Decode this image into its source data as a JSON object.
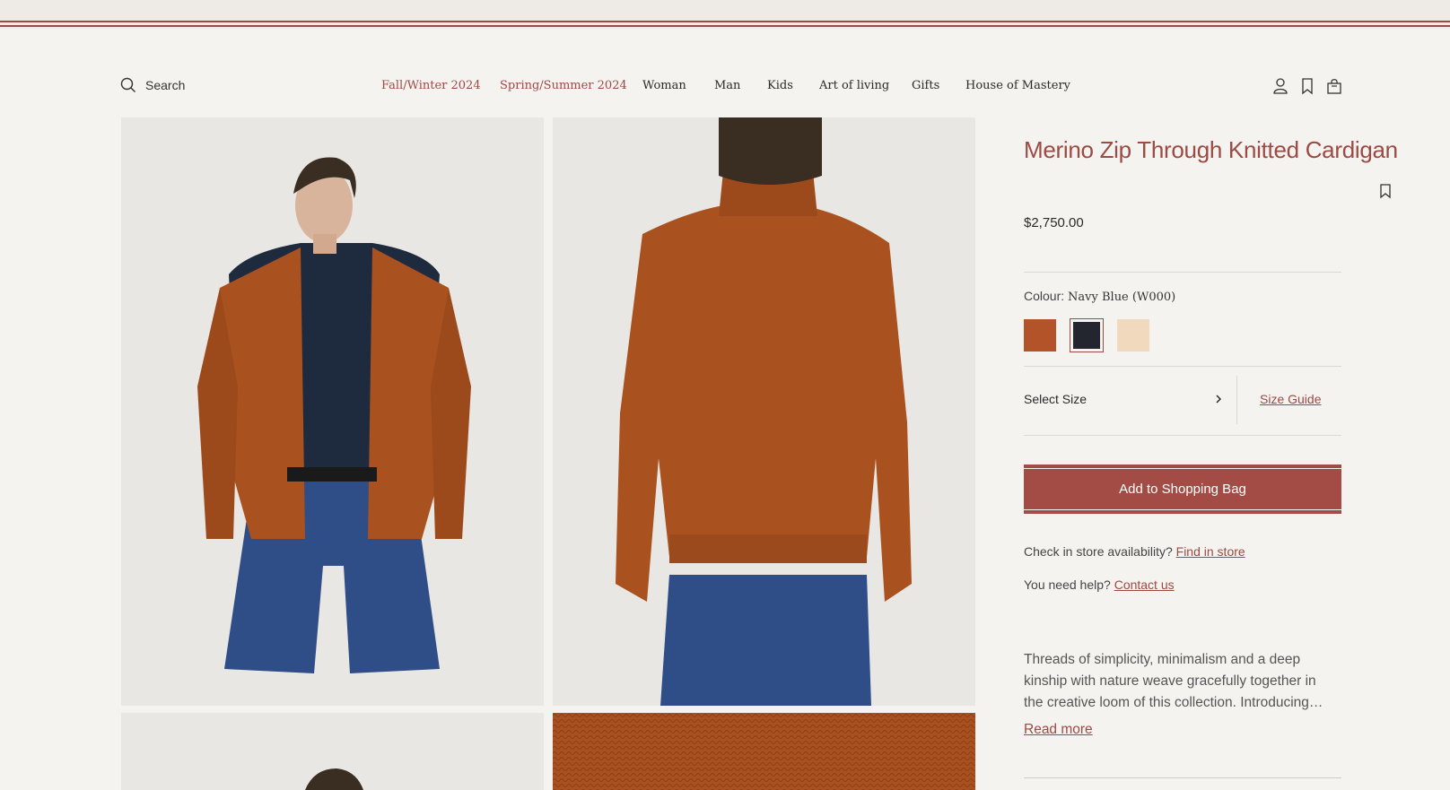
{
  "header": {
    "search_label": "Search",
    "nav": [
      {
        "label": "Fall/Winter 2024"
      },
      {
        "label": "Spring/Summer 2024"
      },
      {
        "label": "Woman"
      },
      {
        "label": "Man"
      },
      {
        "label": "Kids"
      },
      {
        "label": "Art of living"
      },
      {
        "label": "Gifts"
      },
      {
        "label": "House of Mastery"
      }
    ],
    "icons": [
      "account-icon",
      "bookmark-icon",
      "shopping-bag-icon"
    ]
  },
  "product": {
    "title": "Merino Zip Through Knitted Cardigan",
    "price": "$2,750.00",
    "colour_label": "Colour:",
    "colour_value": "Navy Blue (W000)",
    "swatches": [
      {
        "name": "rust",
        "color": "#b3532a"
      },
      {
        "name": "navy-blue",
        "color": "#23252f",
        "selected": true
      },
      {
        "name": "cream",
        "color": "#f0d9bd"
      }
    ],
    "size_label": "Select Size",
    "size_guide": "Size Guide",
    "add_to_bag": "Add to Shopping Bag",
    "store_text": "Check in store availability?",
    "store_link": "Find in store",
    "help_text": "You need help?",
    "help_link": "Contact us",
    "description": "Threads of simplicity, minimalism and a deep kinship with nature weave gracefully together in the creative loom of this collection. Introducing…",
    "read_more": "Read more"
  },
  "colors": {
    "accent": "#9b4a44",
    "button": "#a24c45",
    "background": "#f5f3ef"
  }
}
